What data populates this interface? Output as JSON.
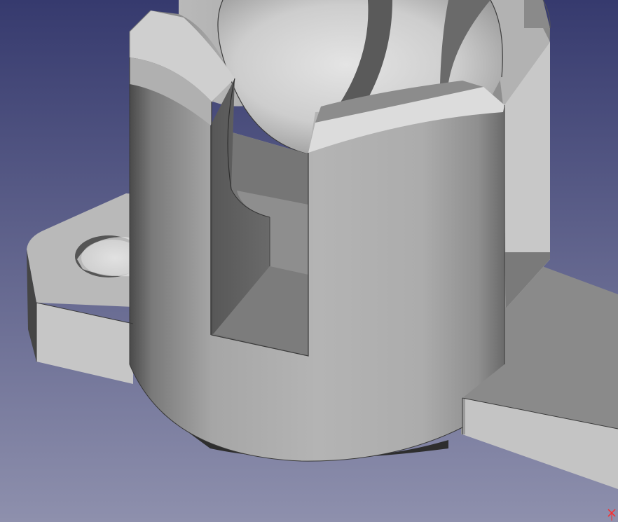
{
  "app": {
    "view": "3d-viewport",
    "object": "cylindrical-clip-mount"
  },
  "icons": {
    "axis_indicator": "axis-cross-icon"
  },
  "colors": {
    "background_top": "#363a6e",
    "background_bottom": "#8e90ad",
    "model_light": "#d0d0d0",
    "model_mid": "#a8a8a8",
    "model_dark": "#5c5c5c",
    "axis_marker": "#ff2a2a"
  }
}
